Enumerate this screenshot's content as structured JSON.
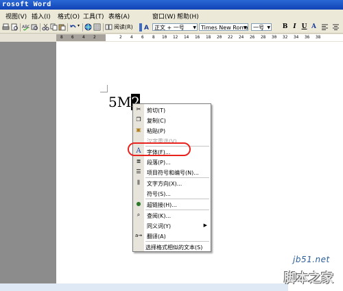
{
  "window": {
    "title": "rosoft Word"
  },
  "menubar": {
    "items": [
      "视图(V)",
      "插入(I)",
      "格式(O)",
      "工具(T)",
      "表格(A)",
      "窗口(W)",
      "帮助(H)"
    ]
  },
  "toolbar": {
    "reading_label": "阅读(R)",
    "style_value": "正文 + 一号",
    "font_value": "Times New Roman",
    "size_value": "一号",
    "bold": "B",
    "italic": "I",
    "underline": "U",
    "font_color": "A"
  },
  "ruler": {
    "ticks": [
      "8",
      "6",
      "4",
      "2",
      "2",
      "4",
      "6",
      "8",
      "10",
      "12",
      "14",
      "16",
      "18",
      "20",
      "22",
      "24",
      "26",
      "28",
      "30",
      "32",
      "34",
      "36",
      "38"
    ]
  },
  "document": {
    "text_before": "5M",
    "selected_text": "2"
  },
  "context_menu": {
    "items": [
      {
        "label": "剪切(T)",
        "icon": "scissors-icon",
        "enabled": true
      },
      {
        "label": "复制(C)",
        "icon": "copy-icon",
        "enabled": true
      },
      {
        "label": "粘贴(P)",
        "icon": "paste-icon",
        "enabled": true
      },
      {
        "label": "汉字重选(V)",
        "icon": "",
        "enabled": false
      },
      {
        "label": "字体(F)...",
        "icon": "font-icon",
        "enabled": true,
        "highlighted": true
      },
      {
        "label": "段落(P)...",
        "icon": "paragraph-icon",
        "enabled": true
      },
      {
        "label": "项目符号和编号(N)...",
        "icon": "bullets-icon",
        "enabled": true
      },
      {
        "label": "文字方向(X)...",
        "icon": "text-direction-icon",
        "enabled": true
      },
      {
        "label": "符号(S)...",
        "icon": "",
        "enabled": true
      },
      {
        "label": "超链接(H)...",
        "icon": "hyperlink-icon",
        "enabled": true
      },
      {
        "label": "查阅(K)...",
        "icon": "research-icon",
        "enabled": true
      },
      {
        "label": "同义词(Y)",
        "icon": "",
        "enabled": true,
        "submenu": true
      },
      {
        "label": "翻译(A)",
        "icon": "translate-icon",
        "enabled": true
      },
      {
        "label": "选择格式相似的文本(S)",
        "icon": "",
        "enabled": true
      }
    ]
  },
  "watermark": {
    "site": "jb51.net",
    "name": "脚本之家"
  },
  "colors": {
    "titlebar": "#1a52c8",
    "highlight_ring": "#e8211c",
    "menu_bg": "#ece9d8"
  }
}
